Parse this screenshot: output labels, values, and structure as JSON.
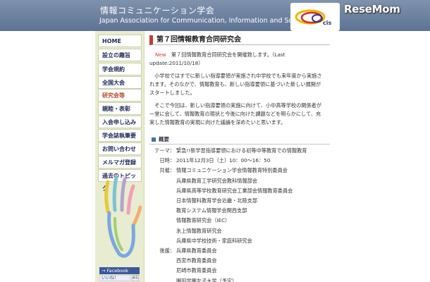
{
  "header": {
    "title": "情報コミュニケーション学会",
    "subtitle": "Japan Association for Communication, Information and Society",
    "logo_text": "cis"
  },
  "watermark": "ReseMom",
  "colors": {
    "header": "#6e83a1",
    "sidebar": "#e8ecd0",
    "title_accent": "#c33a3a",
    "new_label": "#d23b3b"
  },
  "sidebar": {
    "items": [
      {
        "label": "HOME"
      },
      {
        "label": "設立の趣旨"
      },
      {
        "label": "学会規約"
      },
      {
        "label": "全国大会"
      },
      {
        "label": "研究会等"
      },
      {
        "label": "親睦・表彰"
      },
      {
        "label": "入会申し込み"
      },
      {
        "label": "学会誌執筆要項"
      },
      {
        "label": "お問い合わせ"
      },
      {
        "label": "メルマガ登録"
      },
      {
        "label": "過去のトピック"
      }
    ],
    "active_index": 4,
    "facebook_page": "→ Facebook Page",
    "like_label": "いいね！",
    "like_count": "65"
  },
  "main": {
    "title": "第７回情報教育合同研究会",
    "new_label": "New",
    "announcement": "　第７回情報教育合同研究会を開催致します。（Last",
    "announcement_update": "update:2011/10/18）",
    "para1": [
      "　小学校ではすでに新しい指導要領が実施され中学校でも来年度から実施さ",
      "れます。そのなかで、情報教育も、新しい指導要領に基づいた新しい展開が",
      "スタートしました。"
    ],
    "para2": [
      "　そこで今回は、新しい指導要領の実施に向けて、小中高等学校の関係者が",
      "一堂に会して、情報教育の現状と今後に向けた課題などを明らかにして、充",
      "実した情報教育の実現に向けた議論を深めたいと思います。"
    ],
    "section_title": "概要",
    "details": [
      {
        "key": "テーマ：",
        "value": "緊急!!新学習指導要領における初等中等教育での情報教育"
      },
      {
        "key": "日時：",
        "value": "2011年12月3日（土）10：00〜16：50"
      },
      {
        "key": "共催：",
        "value": "情報コミュニケーション学会情報教育特別委員会"
      },
      {
        "key": "",
        "value": "兵庫県教育工学研究会教科情報部会"
      },
      {
        "key": "",
        "value": "兵庫県高等学校教育研究会工業部会情報教育委員会"
      },
      {
        "key": "",
        "value": "日本情報科教育学会近畿・北陸支部"
      },
      {
        "key": "",
        "value": "教育システム情報学会関西支部"
      },
      {
        "key": "",
        "value": "情報教育研究会（IEC）"
      },
      {
        "key": "",
        "value": "氷上情報教育研究会"
      },
      {
        "key": "",
        "value": "兵庫県中学校技術・家庭科研究会"
      },
      {
        "key": "後援：",
        "value": "兵庫県教育委員会"
      },
      {
        "key": "",
        "value": "西宮市教育委員会"
      },
      {
        "key": "",
        "value": "尼崎市教育委員会"
      },
      {
        "key": "",
        "value": "園田学園女子大学（予定）"
      }
    ]
  }
}
